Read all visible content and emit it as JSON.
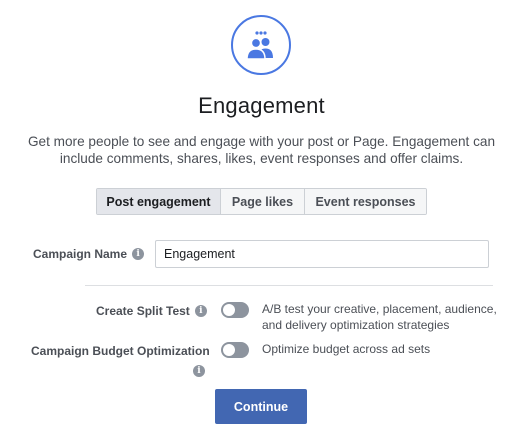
{
  "hero": {
    "icon": "people-icon"
  },
  "title": "Engagement",
  "subtitle_line1": "Get more people to see and engage with your post or Page. Engagement can",
  "subtitle_line2": "include comments, shares, likes, event responses and offer claims.",
  "tabs": [
    {
      "label": "Post engagement",
      "active": true
    },
    {
      "label": "Page likes",
      "active": false
    },
    {
      "label": "Event responses",
      "active": false
    }
  ],
  "campaign_name": {
    "label": "Campaign Name",
    "value": "Engagement"
  },
  "split_test": {
    "label": "Create Split Test",
    "enabled": false,
    "desc_line1": "A/B test your creative, placement, audience,",
    "desc_line2": "and delivery optimization strategies"
  },
  "budget_optimization": {
    "label": "Campaign Budget Optimization",
    "enabled": false,
    "desc": "Optimize budget across ad sets"
  },
  "continue_label": "Continue",
  "colors": {
    "accent": "#4267b2",
    "icon_blue": "#4a78e2",
    "toggle_off": "#8d949e"
  }
}
